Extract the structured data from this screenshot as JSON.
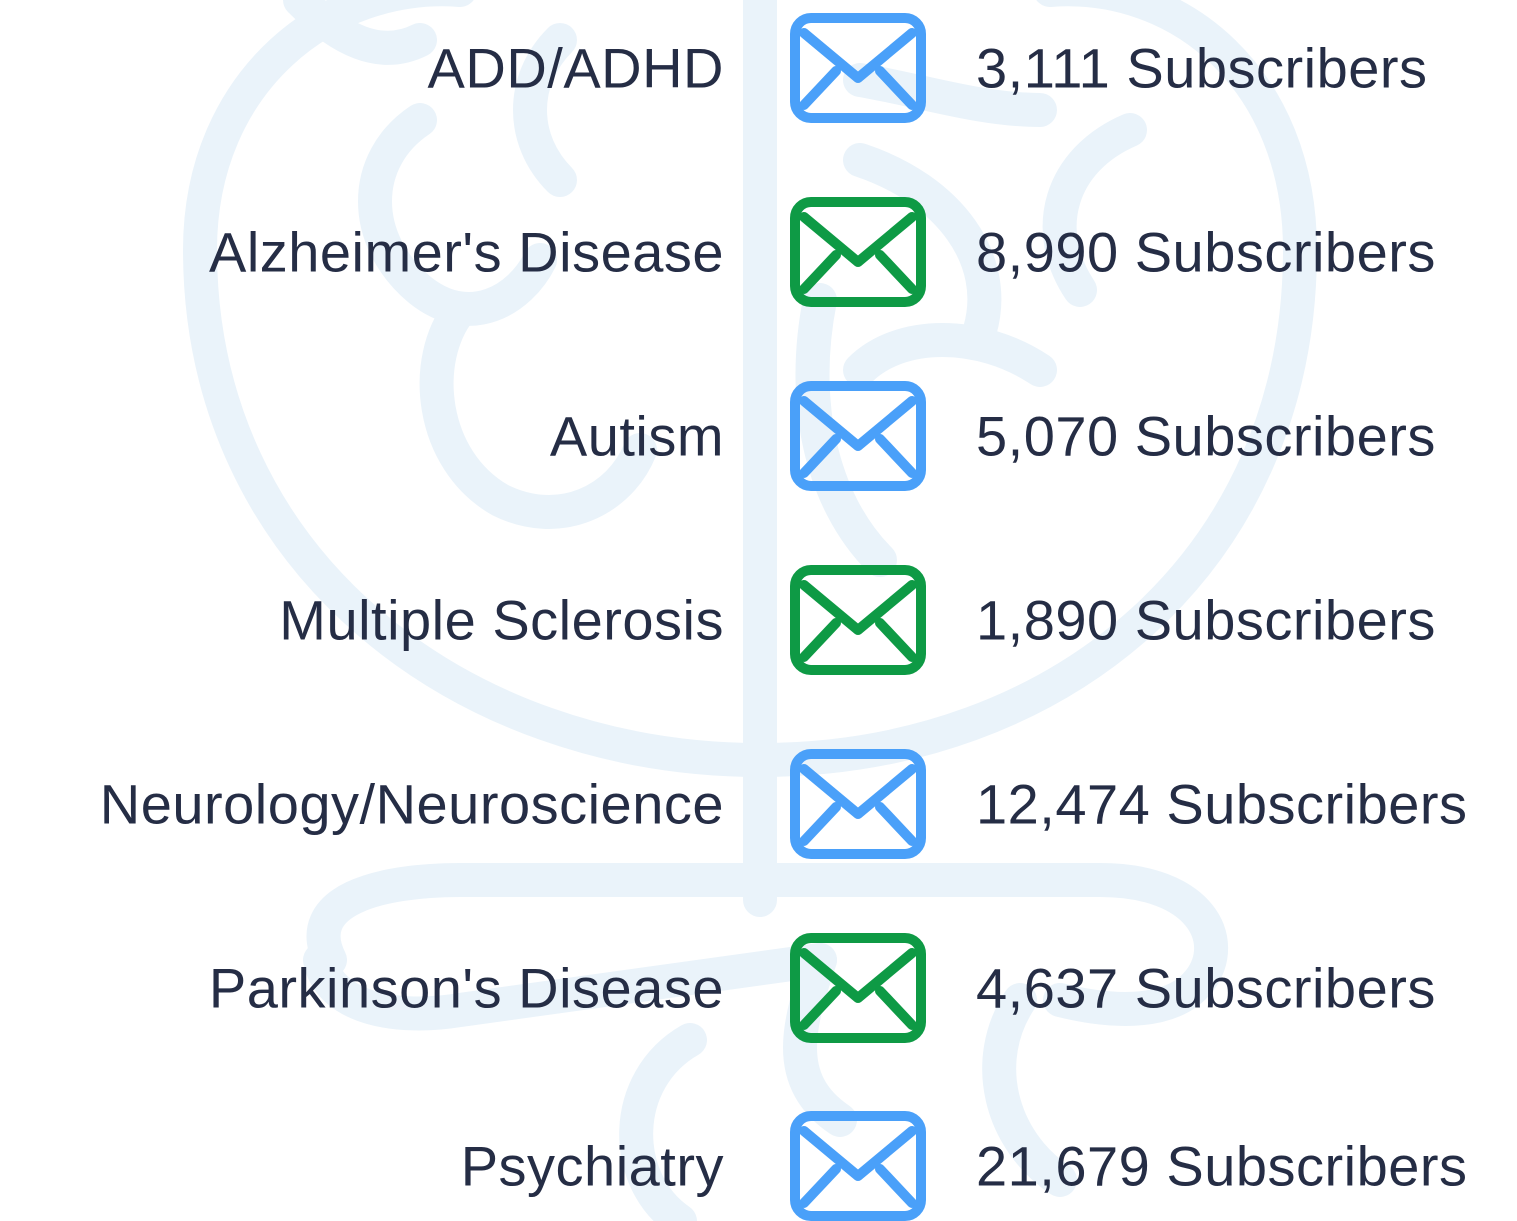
{
  "colors": {
    "text": "#252d45",
    "blue": "#4aa0f9",
    "green": "#0e9a45",
    "watermark": "#eaf3fa"
  },
  "watermark_icon": "brain-outline-icon",
  "rows": [
    {
      "label": "ADD/ADHD",
      "count": "3,111",
      "unit": "Subscribers",
      "icon": "envelope-icon",
      "icon_color": "blue"
    },
    {
      "label": "Alzheimer's Disease",
      "count": "8,990",
      "unit": "Subscribers",
      "icon": "envelope-icon",
      "icon_color": "green"
    },
    {
      "label": "Autism",
      "count": "5,070",
      "unit": "Subscribers",
      "icon": "envelope-icon",
      "icon_color": "blue"
    },
    {
      "label": "Multiple Sclerosis",
      "count": "1,890",
      "unit": "Subscribers",
      "icon": "envelope-icon",
      "icon_color": "green"
    },
    {
      "label": "Neurology/Neuroscience",
      "count": "12,474",
      "unit": "Subscribers",
      "icon": "envelope-icon",
      "icon_color": "blue"
    },
    {
      "label": "Parkinson's Disease",
      "count": "4,637",
      "unit": "Subscribers",
      "icon": "envelope-icon",
      "icon_color": "green"
    },
    {
      "label": "Psychiatry",
      "count": "21,679",
      "unit": "Subscribers",
      "icon": "envelope-icon",
      "icon_color": "blue"
    }
  ]
}
